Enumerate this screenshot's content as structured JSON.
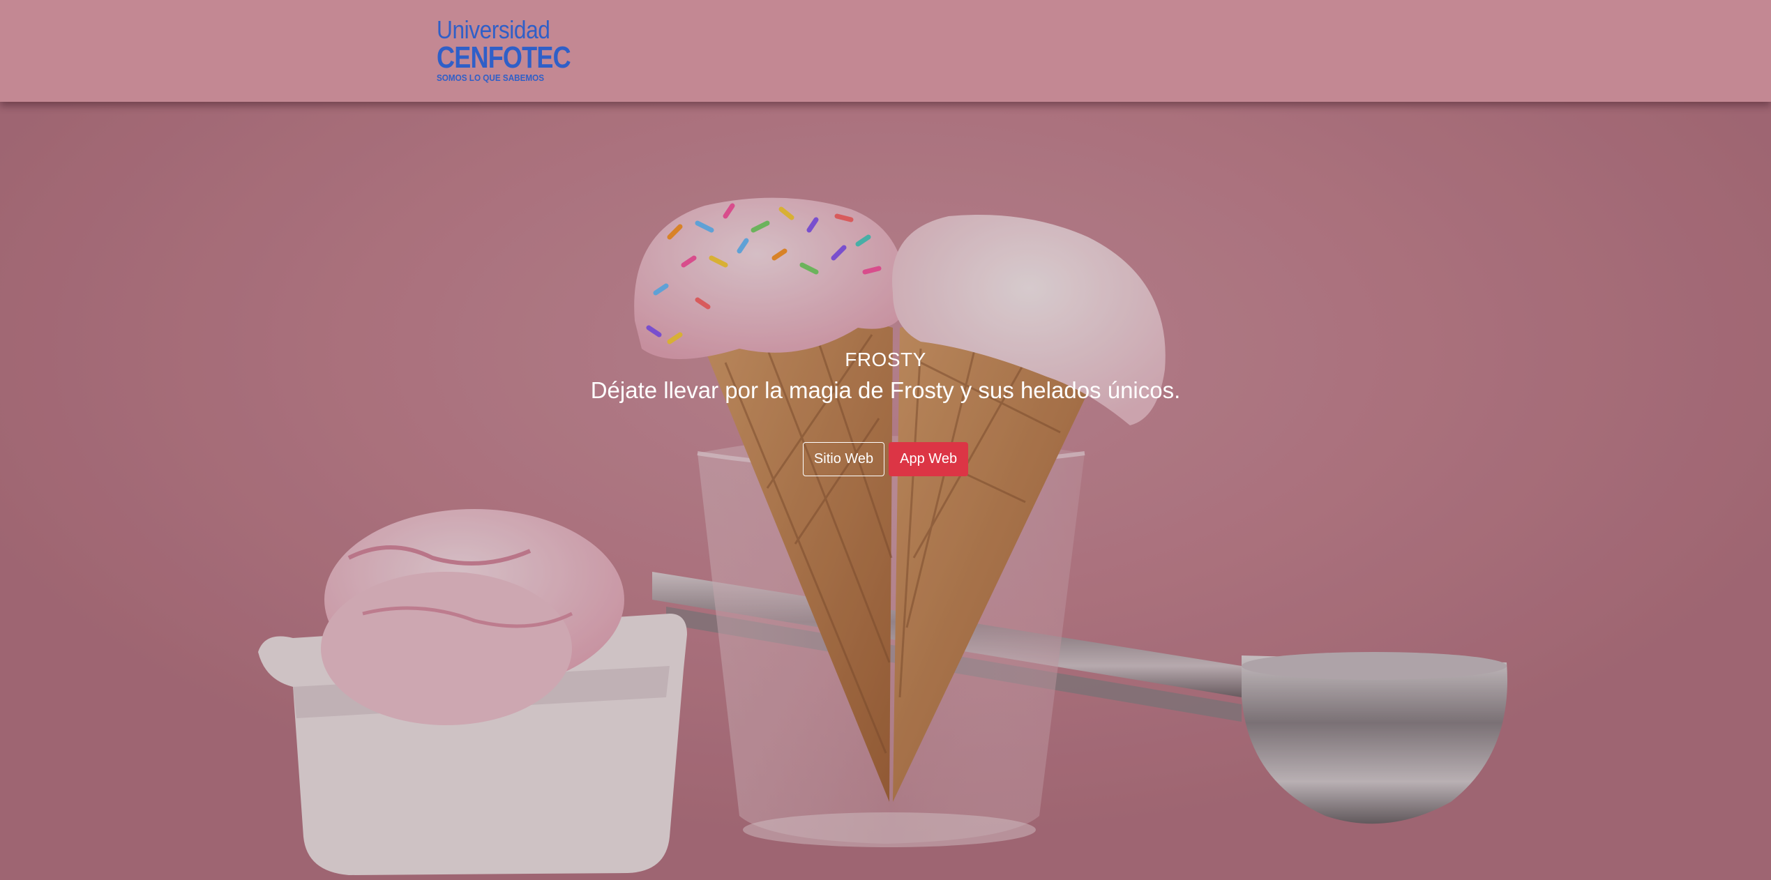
{
  "header": {
    "logo": {
      "line1": "Universidad",
      "line2": "CENFOTEC",
      "tagline": "SOMOS LO QUE SABEMOS",
      "icon": "cenfotec-logo-icon",
      "color": "#2f5fc8"
    }
  },
  "hero": {
    "title": "FROSTY",
    "subtitle": "Déjate llevar por la magia de Frosty y sus helados únicos.",
    "buttons": {
      "sitio_web": "Sitio Web",
      "app_web": "App Web"
    },
    "background_image": "ice-cream-cones-in-glass-photo",
    "accent_color": "#dc3545"
  }
}
